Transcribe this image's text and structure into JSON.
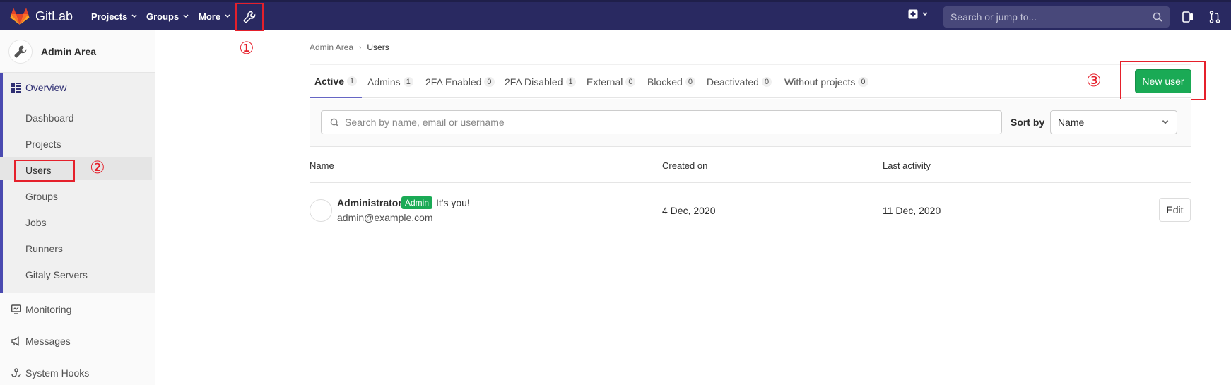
{
  "navbar": {
    "brand": "GitLab",
    "items": [
      {
        "label": "Projects"
      },
      {
        "label": "Groups"
      },
      {
        "label": "More"
      }
    ],
    "search_placeholder": "Search or jump to...",
    "wrench_icon": "wrench-icon"
  },
  "sidebar": {
    "title": "Admin Area",
    "overview": "Overview",
    "items": [
      {
        "label": "Dashboard"
      },
      {
        "label": "Projects"
      },
      {
        "label": "Users"
      },
      {
        "label": "Groups"
      },
      {
        "label": "Jobs"
      },
      {
        "label": "Runners"
      },
      {
        "label": "Gitaly Servers"
      }
    ],
    "monitoring": "Monitoring",
    "messages": "Messages",
    "system_hooks": "System Hooks"
  },
  "annotations": {
    "one": "①",
    "two": "②",
    "three": "③"
  },
  "breadcrumb": {
    "parent": "Admin Area",
    "current": "Users"
  },
  "tabs": [
    {
      "label": "Active",
      "count": "1"
    },
    {
      "label": "Admins",
      "count": "1"
    },
    {
      "label": "2FA Enabled",
      "count": "0"
    },
    {
      "label": "2FA Disabled",
      "count": "1"
    },
    {
      "label": "External",
      "count": "0"
    },
    {
      "label": "Blocked",
      "count": "0"
    },
    {
      "label": "Deactivated",
      "count": "0"
    },
    {
      "label": "Without projects",
      "count": "0"
    }
  ],
  "new_user_label": "New user",
  "filter": {
    "placeholder": "Search by name, email or username",
    "sort_label": "Sort by",
    "sort_value": "Name"
  },
  "table": {
    "headers": {
      "name": "Name",
      "created": "Created on",
      "activity": "Last activity"
    },
    "rows": [
      {
        "name": "Administrator",
        "badge": "Admin",
        "note": "It's you!",
        "email": "admin@example.com",
        "created": "4 Dec, 2020",
        "activity": "11 Dec, 2020",
        "edit": "Edit"
      }
    ]
  },
  "colors": {
    "navbar": "#292961",
    "accent_green": "#1aaa55",
    "annotation_red": "#e5202b",
    "sidebar_accent": "#4a4ab0"
  }
}
